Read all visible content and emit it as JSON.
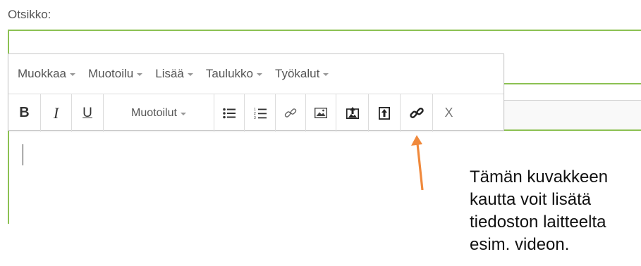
{
  "field": {
    "title_label": "Otsikko:"
  },
  "menubar": {
    "items": [
      {
        "label": "Muokkaa"
      },
      {
        "label": "Muotoilu"
      },
      {
        "label": "Lisää"
      },
      {
        "label": "Taulukko"
      },
      {
        "label": "Työkalut"
      }
    ]
  },
  "toolbar": {
    "bold": "B",
    "italic": "I",
    "underline": "U",
    "formats_label": "Muotoilut",
    "clear": "X",
    "icons": [
      "bold-icon",
      "italic-icon",
      "underline-icon",
      "bullet-list-icon",
      "numbered-list-icon",
      "link-icon",
      "image-icon",
      "upload-icon",
      "file-upload-icon",
      "link-icon",
      "remove-format-icon"
    ]
  },
  "annotation": {
    "lines": [
      "Tämän kuvakkeen",
      "kautta voit lisätä",
      "tiedoston laitteelta",
      "esim. videon."
    ]
  },
  "colors": {
    "accent": "#8cc152",
    "arrow": "#f0893c",
    "border": "#c8c8c8"
  }
}
